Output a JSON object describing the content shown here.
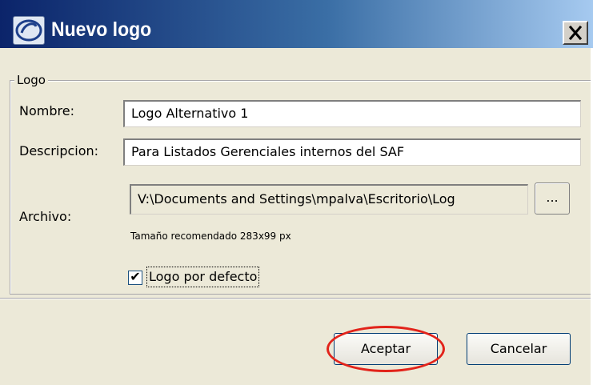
{
  "window": {
    "title": "Nuevo logo",
    "close_label": "X"
  },
  "group": {
    "legend": "Logo"
  },
  "form": {
    "nombre_label": "Nombre:",
    "nombre_value": "Logo Alternativo 1",
    "descripcion_label": "Descripcion:",
    "descripcion_value": "Para Listados Gerenciales internos del SAF",
    "archivo_label": "Archivo:",
    "archivo_value": "V:\\Documents and Settings\\mpalva\\Escritorio\\Log",
    "browse_label": "...",
    "size_hint": "Tamaño recomendado 283x99 px",
    "default_checkbox_label": "Logo por defecto",
    "default_checked": true,
    "check_mark": "✔"
  },
  "buttons": {
    "accept": "Aceptar",
    "cancel": "Cancelar"
  },
  "colors": {
    "titlebar_start": "#0b246a",
    "titlebar_end": "#a6caf0",
    "dialog_bg": "#ece9d8",
    "highlight_ellipse": "#e2231a"
  }
}
